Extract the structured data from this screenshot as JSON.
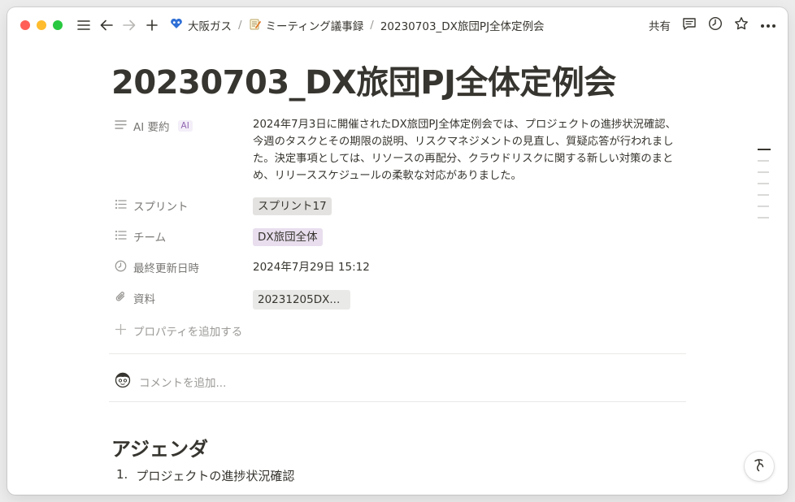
{
  "breadcrumb": {
    "workspace": "大阪ガス",
    "parent": "ミーティング議事録",
    "current": "20230703_DX旅団PJ全体定例会"
  },
  "toolbar": {
    "share_label": "共有"
  },
  "page": {
    "title": "20230703_DX旅団PJ全体定例会"
  },
  "properties": {
    "ai_summary": {
      "label": "AI 要約",
      "badge": "AI",
      "value": "2024年7月3日に開催されたDX旅団PJ全体定例会では、プロジェクトの進捗状況確認、今週のタスクとその期限の説明、リスクマネジメントの見直し、質疑応答が行われました。決定事項としては、リソースの再配分、クラウドリスクに関する新しい対策のまとめ、リリーススケジュールの柔軟な対応がありました。"
    },
    "sprint": {
      "label": "スプリント",
      "value": "スプリント17"
    },
    "team": {
      "label": "チーム",
      "value": "DX旅団全体"
    },
    "last_updated": {
      "label": "最終更新日時",
      "value": "2024年7月29日 15:12"
    },
    "materials": {
      "label": "資料",
      "value": "20231205DX..."
    },
    "add_property": "プロパティを追加する"
  },
  "comment": {
    "placeholder": "コメントを追加..."
  },
  "content": {
    "heading": "アジェンダ",
    "list": [
      {
        "number": "1.",
        "text": "プロジェクトの進捗状況確認"
      }
    ]
  },
  "colors": {
    "text": "#37352f",
    "muted": "#787774",
    "tag_gray": "#e3e2e0",
    "tag_purple": "#e8deee",
    "ai_accent": "#9065b0"
  },
  "icons": [
    "menu-icon",
    "back-arrow-icon",
    "forward-arrow-icon",
    "plus-icon",
    "workspace-logo-icon",
    "memo-icon",
    "comment-icon",
    "clock-icon",
    "star-icon",
    "more-icon",
    "text-lines-icon",
    "list-icon",
    "clock-icon",
    "paperclip-icon",
    "plus-icon",
    "avatar",
    "help-icon"
  ]
}
